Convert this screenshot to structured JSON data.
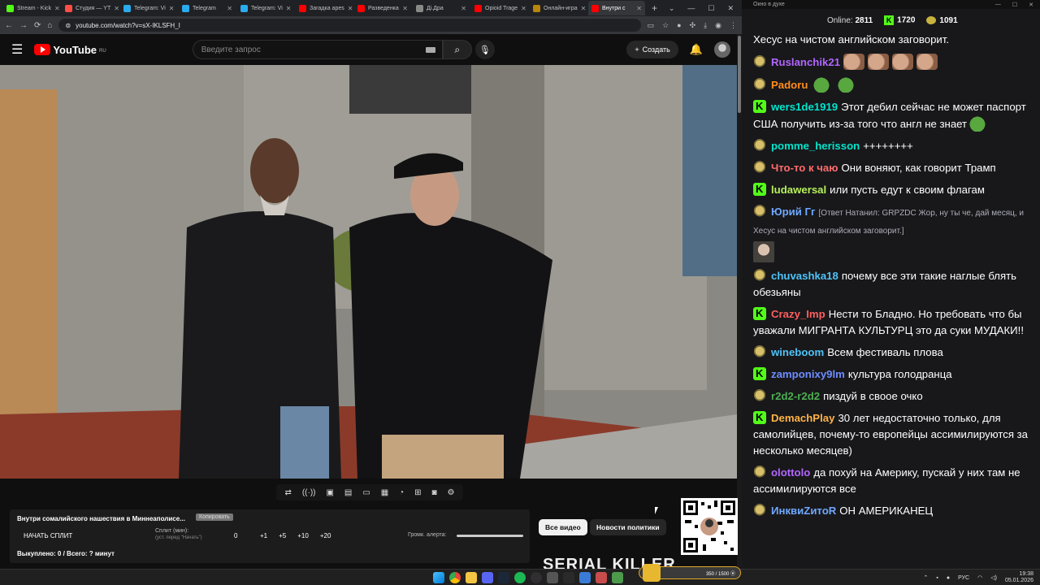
{
  "browser": {
    "tabs": [
      {
        "label": "Stream - Kick",
        "color": "#53fc18"
      },
      {
        "label": "Студия — YT",
        "color": "#ff4e45"
      },
      {
        "label": "Telegram: Vi",
        "color": "#2aabee"
      },
      {
        "label": "Telegram",
        "color": "#2aabee"
      },
      {
        "label": "Telegram: Vi",
        "color": "#2aabee"
      },
      {
        "label": "Загадка ареs",
        "color": "#ff0000"
      },
      {
        "label": "Разведенка",
        "color": "#ff0000"
      },
      {
        "label": "Дi.Дра",
        "color": "#888888"
      },
      {
        "label": "Opioid Trage",
        "color": "#ff0000"
      },
      {
        "label": "Онлайн-игра",
        "color": "#b8860b"
      },
      {
        "label": "Внутри с",
        "color": "#ff0000",
        "active": true
      }
    ],
    "new_tab": "+",
    "window_controls": [
      "⌄",
      "—",
      "☐",
      "✕"
    ],
    "url": "youtube.com/watch?v=sX-IKLSFH_I"
  },
  "youtube": {
    "logo_text": "YouTube",
    "logo_region": "RU",
    "search_placeholder": "Введите запрос",
    "create_label": "Создать"
  },
  "split_panel": {
    "title": "Внутри сомалийского нашествия в Миннеаполисе...",
    "copy_label": "Копировать",
    "start_label": "НАЧАТЬ СПЛИТ",
    "split_label": "Сплит (мин):",
    "split_hint": "(уст. перед \"Начать\")",
    "split_value": "0",
    "increments": [
      "+1",
      "+5",
      "+10",
      "+20"
    ],
    "volume_label": "Громк. алерта:",
    "bought": "Выкуплено: 0 / Всего: ? минут"
  },
  "chips": {
    "all": "Все видео",
    "news": "Новости политики"
  },
  "banner_text": "SERIAL KILLER",
  "chat": {
    "window_title": "Окно в духе",
    "online_label": "Online:",
    "online_value": "2811",
    "kick_count": "1720",
    "coin_count": "1091",
    "messages": [
      {
        "badge": "none",
        "user": "",
        "color": "#ffffff",
        "text": "Хесус на чистом английском заговорит."
      },
      {
        "badge": "frog",
        "user": "Ruslanchik21",
        "color": "#b266ff",
        "text": "",
        "emotes": [
          "hand",
          "hand",
          "hand",
          "hand"
        ]
      },
      {
        "badge": "frog",
        "user": "Padoru",
        "color": "#ff8c1a",
        "text": "",
        "emotes": [
          "pepe",
          "pepe"
        ]
      },
      {
        "badge": "kick",
        "user": "wers1de1919",
        "color": "#00e5cc",
        "text": "Этот дебил сейчас не может паспорт США получить из-за того что англ не знает",
        "emotes_after": [
          "pepe"
        ]
      },
      {
        "badge": "frog",
        "user": "pomme_herisson",
        "color": "#00e5cc",
        "text": "++++++++"
      },
      {
        "badge": "frog",
        "user": "Что-то к чаю",
        "color": "#ff6b6b",
        "text": "Они воняют, как говорит Трамп"
      },
      {
        "badge": "kick",
        "user": "ludawersal",
        "color": "#b7f05a",
        "text": "или пусть едут к своим флагам"
      },
      {
        "badge": "frog",
        "user": "Юрий Гг",
        "color": "#6fa8ff",
        "text": "",
        "reply": "[Ответ Натанил: GRPZDC Жор, ну ты че, дай месяц, и Хесус на чистом английском заговорит.]"
      },
      {
        "badge": "frog",
        "user": "chuvashka18",
        "color": "#4fc3f7",
        "text": "почему все эти такие наглые блять обезьяны"
      },
      {
        "badge": "kick",
        "user": "Crazy_Imp",
        "color": "#ff5e5e",
        "text": "Нести то Бладно. Но требовать что бы уважали МИГРАНТА КУЛЬТУРЦ это да суки МУДАКИ!!"
      },
      {
        "badge": "frog",
        "user": "wineboom",
        "color": "#4fc3f7",
        "text": "Всем фестиваль плова"
      },
      {
        "badge": "kick",
        "user": "zamponixy9lm",
        "color": "#6f8cff",
        "text": "культура голодранца"
      },
      {
        "badge": "frog",
        "user": "r2d2-r2d2",
        "color": "#4caf50",
        "text": "пиздуй в своое очко"
      },
      {
        "badge": "kick",
        "user": "DemachPlay",
        "color": "#ffb347",
        "text": "30 лет недостаточно только, для самолийцев, почему-то европейцы ассимилируются за несколько месяцев)"
      },
      {
        "badge": "frog",
        "user": "olottolo",
        "color": "#b266ff",
        "text": "да похуй на Америку, пускай у них там не ассимилируются все"
      },
      {
        "badge": "frog",
        "user": "ИнквиZитоR",
        "color": "#6fa8ff",
        "text": "ОН АМЕРИКАНЕЦ"
      }
    ]
  },
  "widget": {
    "text": "350 / 1500 ⦿"
  },
  "taskbar": {
    "lang": "РУС",
    "time": "19:38",
    "date": "05.01.2026"
  }
}
